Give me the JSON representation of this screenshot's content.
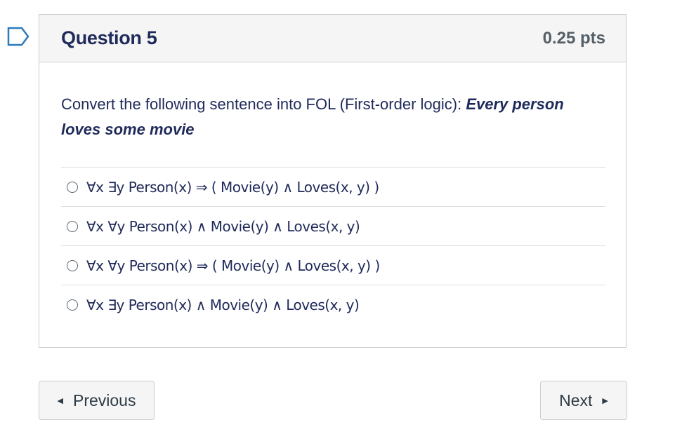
{
  "question": {
    "title": "Question 5",
    "points": "0.25 pts",
    "prompt": "Convert the following sentence into FOL (First-order logic): ",
    "prompt_emphasis": "Every person loves some movie",
    "answers": [
      "∀x ∃y Person(x) ⇒ ( Movie(y) ∧ Loves(x, y) )",
      "∀x ∀y Person(x) ∧ Movie(y) ∧ Loves(x, y)",
      "∀x ∀y Person(x) ⇒ ( Movie(y) ∧ Loves(x, y) )",
      "∀x ∃y Person(x) ∧ Movie(y) ∧ Loves(x, y)"
    ]
  },
  "navigation": {
    "previous_label": "Previous",
    "next_label": "Next",
    "previous_icon": "triangle-left-icon",
    "next_icon": "triangle-right-icon"
  },
  "flag_icon": "bookmark-flag-icon",
  "colors": {
    "flag": "#2b7abc",
    "title_text": "#1f2a5a",
    "points_text": "#555f68",
    "header_bg": "#f5f5f5",
    "border": "#c7cdd1"
  }
}
